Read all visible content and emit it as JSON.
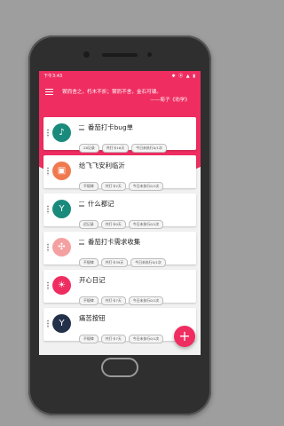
{
  "status_bar": {
    "time": "下午3:43",
    "icons": "✱ ⦿ ▲ ▮"
  },
  "header": {
    "quote_line1": "锲而舍之，朽木不折；锲而不舍，金石可镂。",
    "quote_line2": "——荀子《劝学》"
  },
  "colors": {
    "accent": "#ef2d61",
    "background": "#f1f1f1"
  },
  "cards": [
    {
      "title": "番茄打卡bug单",
      "icon": "music-note-icon",
      "color": "#1a8a7c",
      "glyph": "♪",
      "tags": [
        "28记录",
        "共打卡16天",
        "今日未执行0/1次"
      ]
    },
    {
      "title": "给飞飞安利临沂",
      "icon": "briefcase-icon",
      "color": "#f07a4f",
      "glyph": "▣",
      "tags": [
        "不规律",
        "共打卡2天",
        "今日未执行0/1次"
      ]
    },
    {
      "title": "什么都记",
      "icon": "cocktail-glass-icon",
      "color": "#1a8a7c",
      "glyph": "Y",
      "tags": [
        "迟记录",
        "共打卡0天",
        "今日未执行0/1次"
      ]
    },
    {
      "title": "番茄打卡需求收集",
      "icon": "pinwheel-icon",
      "color": "#f5a0a0",
      "glyph": "✣",
      "tags": [
        "不规律",
        "共打卡39天",
        "今日未执行0/1次"
      ]
    },
    {
      "title": "开心日记",
      "icon": "sun-icon",
      "color": "#ef2d61",
      "glyph": "☀",
      "tags": [
        "不规律",
        "共打卡7天",
        "今日未执行0/1次"
      ]
    },
    {
      "title": "痛苦按钮",
      "icon": "cocktail-glass-icon",
      "color": "#22304a",
      "glyph": "Y",
      "tags": [
        "不规律",
        "共打卡7天",
        "今日未执行0/1次"
      ]
    }
  ],
  "fab": {
    "label": "+"
  }
}
